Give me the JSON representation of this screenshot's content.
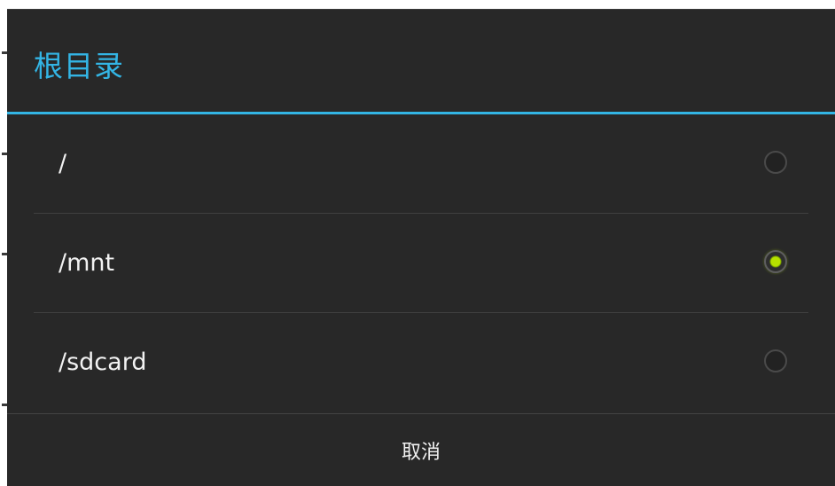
{
  "dialog": {
    "title": "根目录",
    "options": [
      {
        "label": "/",
        "selected": false
      },
      {
        "label": "/mnt",
        "selected": true
      },
      {
        "label": "/sdcard",
        "selected": false
      }
    ],
    "cancel_label": "取消"
  },
  "colors": {
    "accent": "#33b5e5",
    "dialog_background": "#282828",
    "radio_checked": "#b6e000",
    "text": "#f2f2f2"
  }
}
